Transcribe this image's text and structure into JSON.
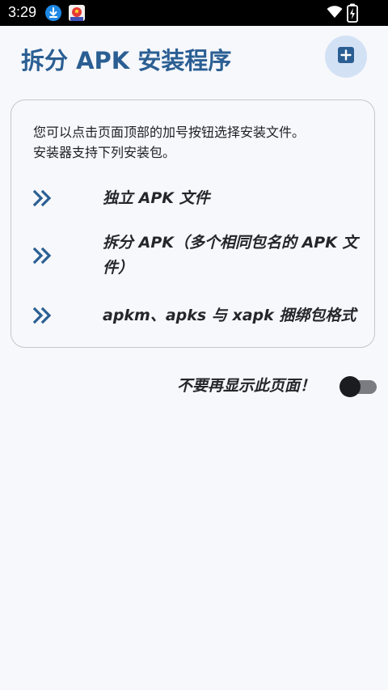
{
  "status_bar": {
    "time": "3:29"
  },
  "header": {
    "title": "拆分 APK 安装程序",
    "add_icon": "add-box-icon"
  },
  "info_card": {
    "description_lines": [
      "您可以点击页面顶部的加号按钮选择安装文件。",
      "安装器支持下列安装包。"
    ],
    "bullet_icon": "double-chevron-right-icon",
    "formats": [
      {
        "label": "独立 APK 文件"
      },
      {
        "label": "拆分 APK（多个相同包名的 APK 文件）"
      },
      {
        "label": "apkm、apks 与 xapk 捆绑包格式"
      }
    ]
  },
  "footer_option": {
    "label": "不要再显示此页面！",
    "toggle_on": false
  },
  "colors": {
    "accent": "#2b5f93",
    "background": "#f7f8fc",
    "fab_background": "#d3e1f5",
    "card_border": "#c5c6cb"
  }
}
